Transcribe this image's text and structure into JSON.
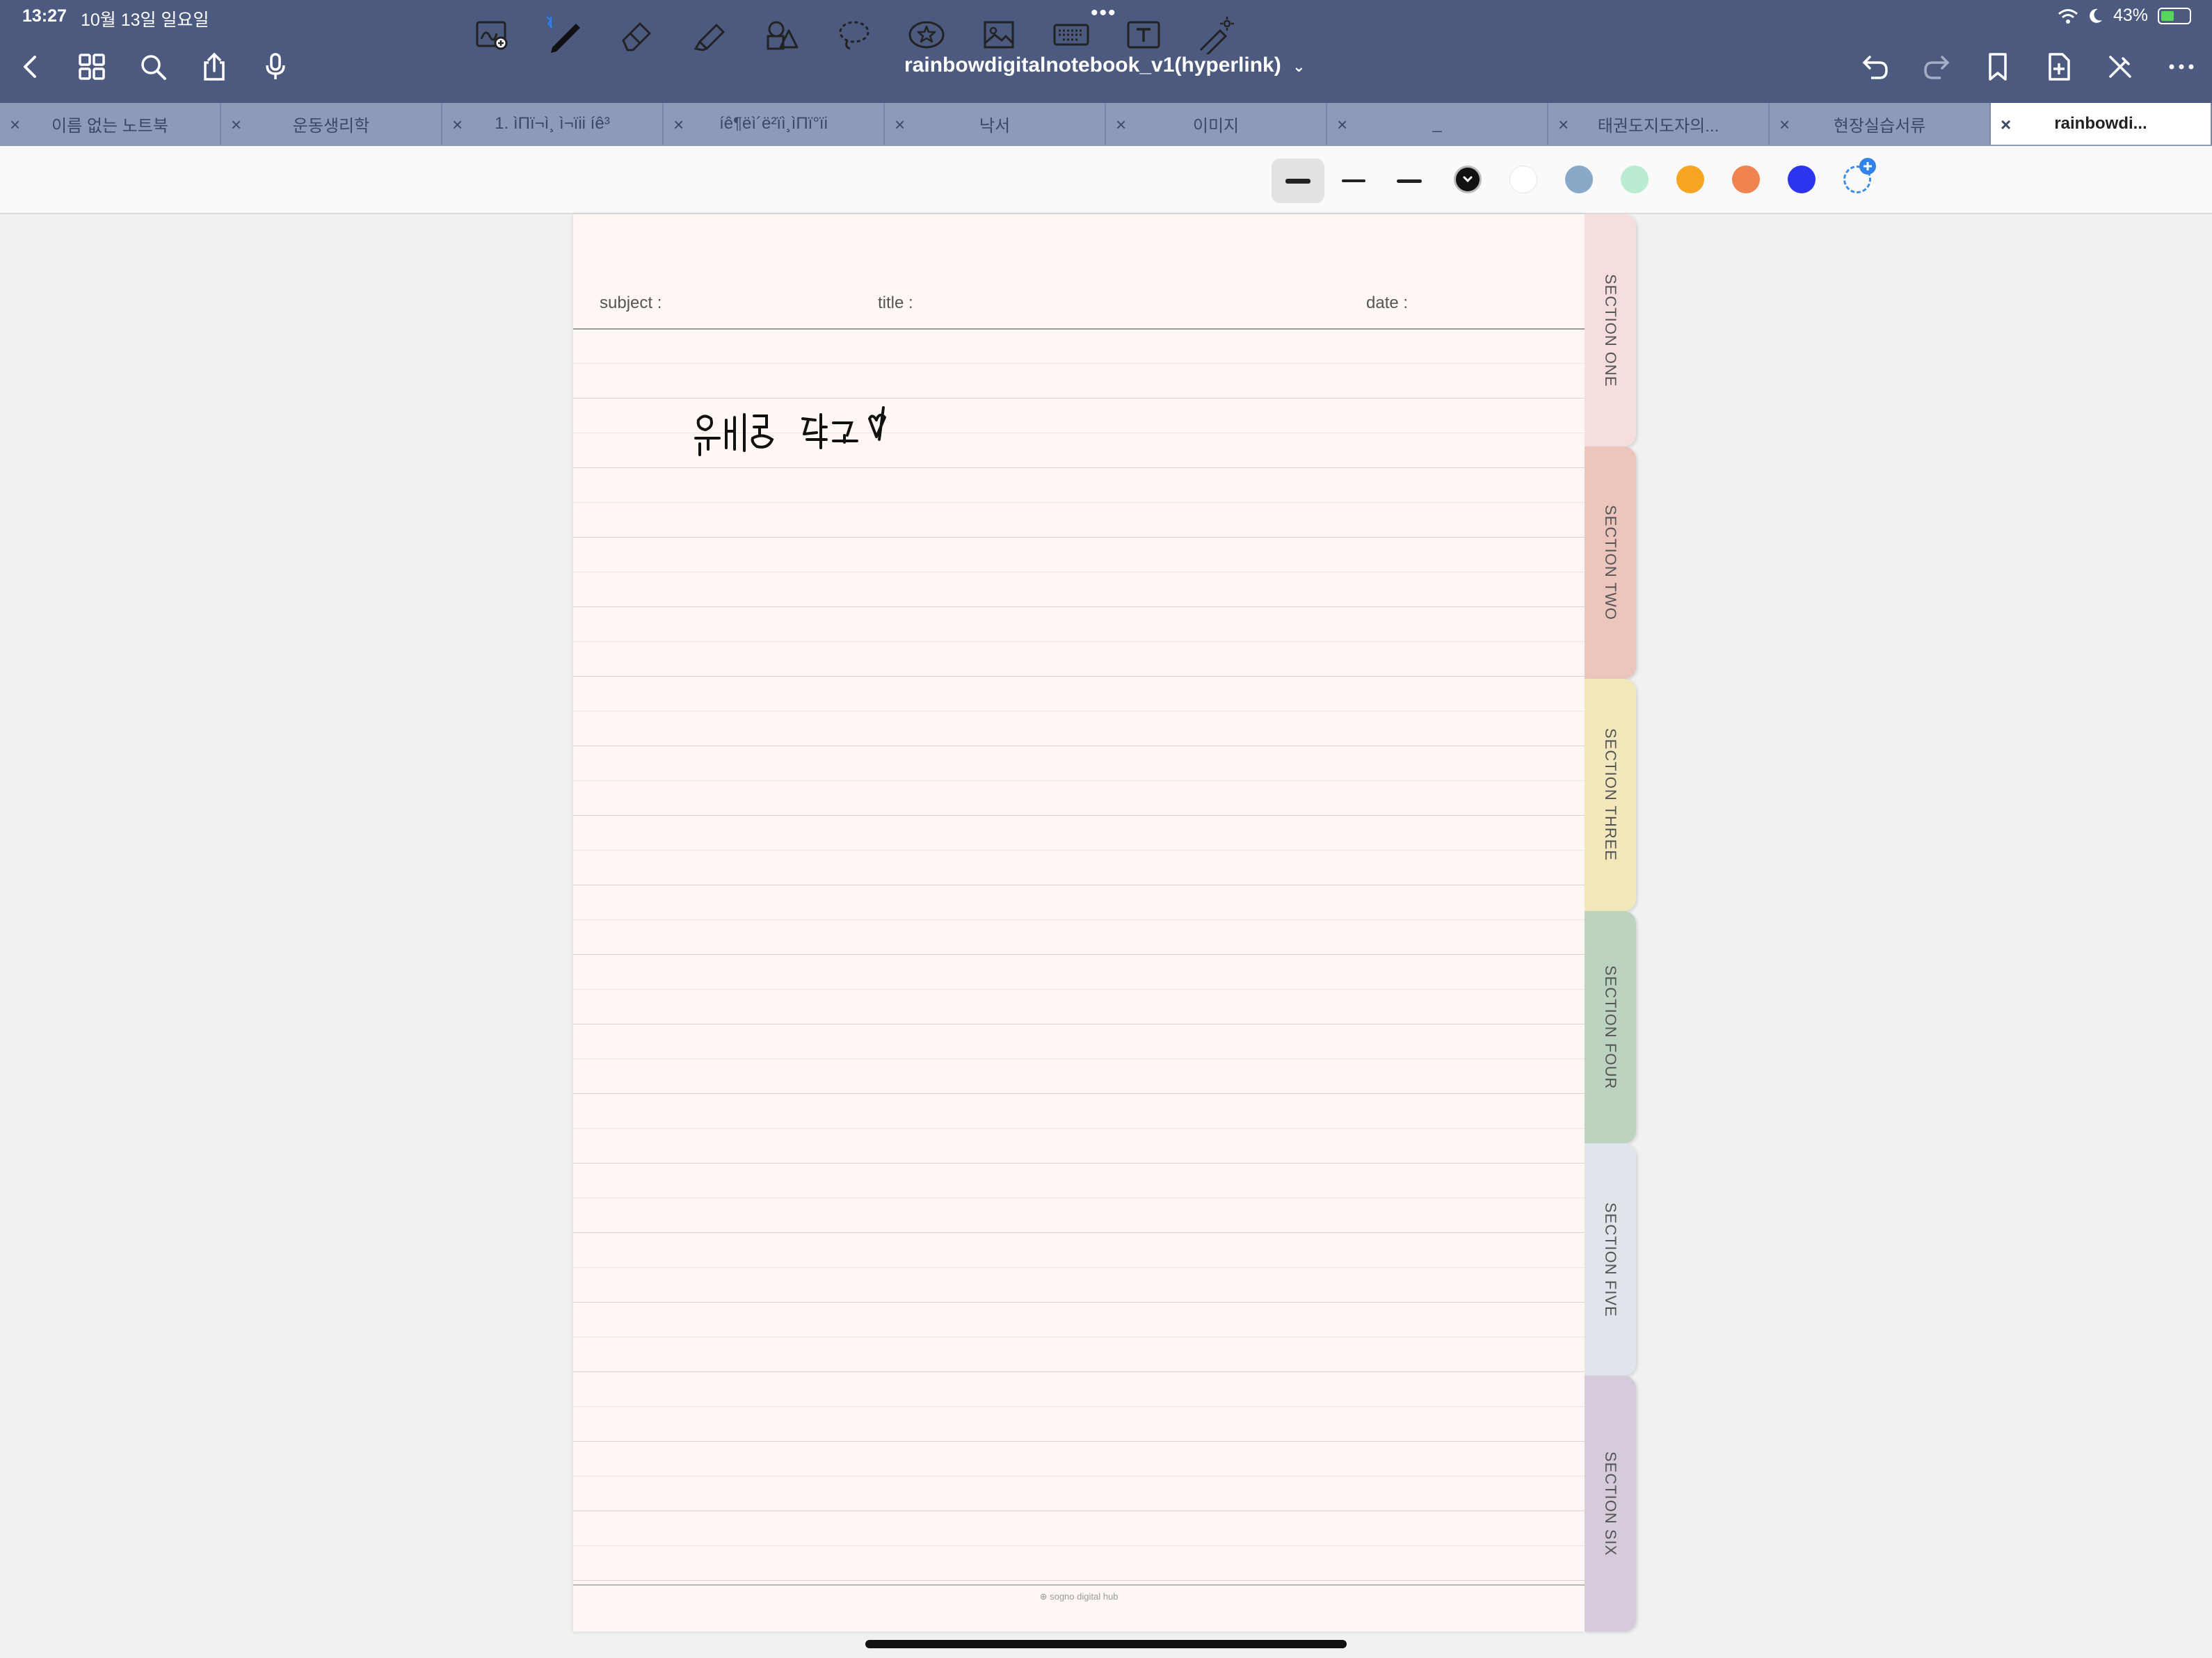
{
  "status": {
    "time": "13:27",
    "date": "10월 13일 일요일",
    "dots": "•••",
    "battery": "43%"
  },
  "title_bar": {
    "document_title": "rainbowdigitalnotebook_v1(hyperlink)",
    "chevron": "⌄"
  },
  "tabs": [
    {
      "label": "이름 없는 노트북",
      "active": false
    },
    {
      "label": "운동생리학",
      "active": false
    },
    {
      "label": "1. ìΠï¬ì¸ ì¬ïii íê³",
      "active": false
    },
    {
      "label": "íê¶ëì´ë²ïì¸ìΠï°ïi",
      "active": false
    },
    {
      "label": "낙서",
      "active": false
    },
    {
      "label": "이미지",
      "active": false
    },
    {
      "label": "_",
      "active": false
    },
    {
      "label": "태권도지도자의...",
      "active": false
    },
    {
      "label": "현장실습서류",
      "active": false
    },
    {
      "label": "rainbowdi...",
      "active": true
    }
  ],
  "colors": {
    "nav_bg": "#4d5a7f",
    "tab_bg": "#8f9ab8",
    "palette": [
      "#111111",
      "#ffffff",
      "#8aa9c9",
      "#b9ecd0",
      "#f6a623",
      "#ef8450",
      "#2b35f0"
    ]
  },
  "notebook": {
    "subject_label": "subject :",
    "title_label": "title :",
    "date_label": "date :",
    "footer": "⊕ sogno digital hub",
    "handwriting": "위버딩 최고 ♡"
  },
  "sections": [
    {
      "label": "SECTION ONE",
      "color": "#f6dede"
    },
    {
      "label": "SECTION TWO",
      "color": "#ecc5bc"
    },
    {
      "label": "SECTION THREE",
      "color": "#f2e8bb"
    },
    {
      "label": "SECTION FOUR",
      "color": "#bcd3bf"
    },
    {
      "label": "SECTION FIVE",
      "color": "#dfe5ea"
    },
    {
      "label": "SECTION SIX",
      "color": "#d5cbda"
    }
  ]
}
